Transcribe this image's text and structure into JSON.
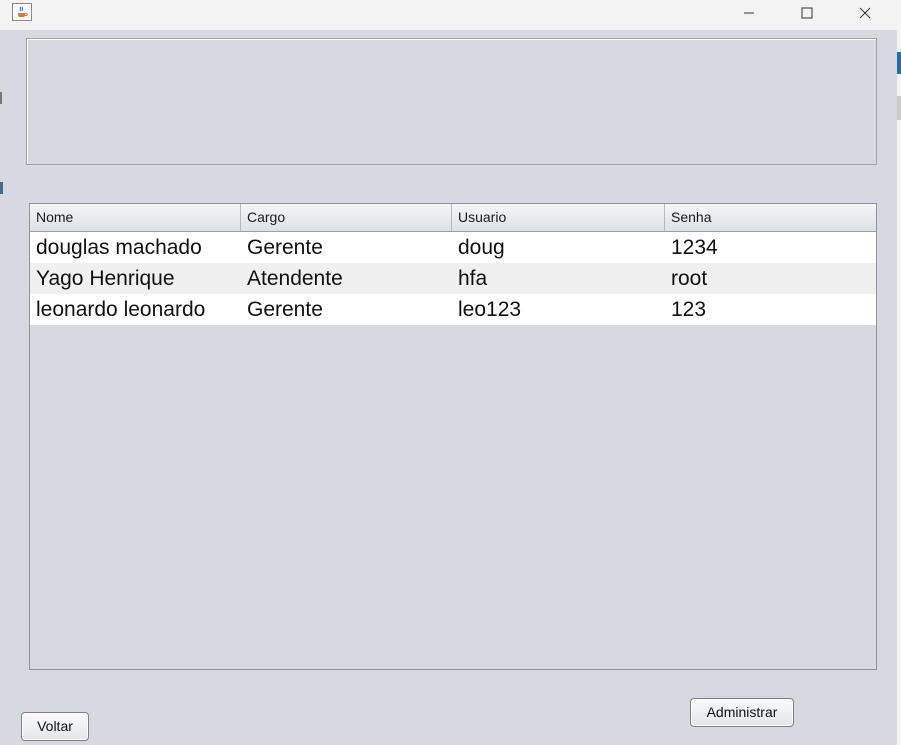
{
  "window": {
    "app_icon": "java-cup-icon",
    "controls": {
      "minimize_icon": "minimize-icon",
      "maximize_icon": "maximize-icon",
      "close_icon": "close-icon"
    }
  },
  "table": {
    "columns": [
      "Nome",
      "Cargo",
      "Usuario",
      "Senha"
    ],
    "rows": [
      [
        "douglas machado",
        "Gerente",
        "doug",
        "1234"
      ],
      [
        "Yago Henrique",
        "Atendente",
        "hfa",
        "root"
      ],
      [
        "leonardo leonardo",
        "Gerente",
        "leo123",
        "123"
      ]
    ]
  },
  "buttons": {
    "voltar_label": "Voltar",
    "administrar_label": "Administrar"
  }
}
